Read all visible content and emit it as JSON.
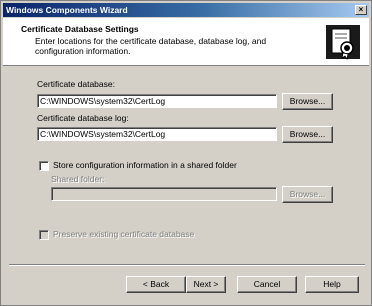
{
  "window": {
    "title": "Windows Components Wizard",
    "close_glyph": "×"
  },
  "header": {
    "title": "Certificate Database Settings",
    "subtitle": "Enter locations for the certificate database, database log, and configuration information."
  },
  "db": {
    "label": "Certificate database:",
    "value": "C:\\WINDOWS\\system32\\CertLog",
    "browse_label": "Browse..."
  },
  "dblog": {
    "label": "Certificate database log:",
    "value": "C:\\WINDOWS\\system32\\CertLog",
    "browse_label": "Browse..."
  },
  "shared": {
    "checkbox_label": "Store configuration information in a shared folder",
    "folder_label": "Shared folder:",
    "folder_value": "",
    "browse_label": "Browse..."
  },
  "preserve": {
    "checkbox_label": "Preserve existing certificate database"
  },
  "footer": {
    "back_label": "< Back",
    "next_label": "Next >",
    "cancel_label": "Cancel",
    "help_label": "Help"
  }
}
